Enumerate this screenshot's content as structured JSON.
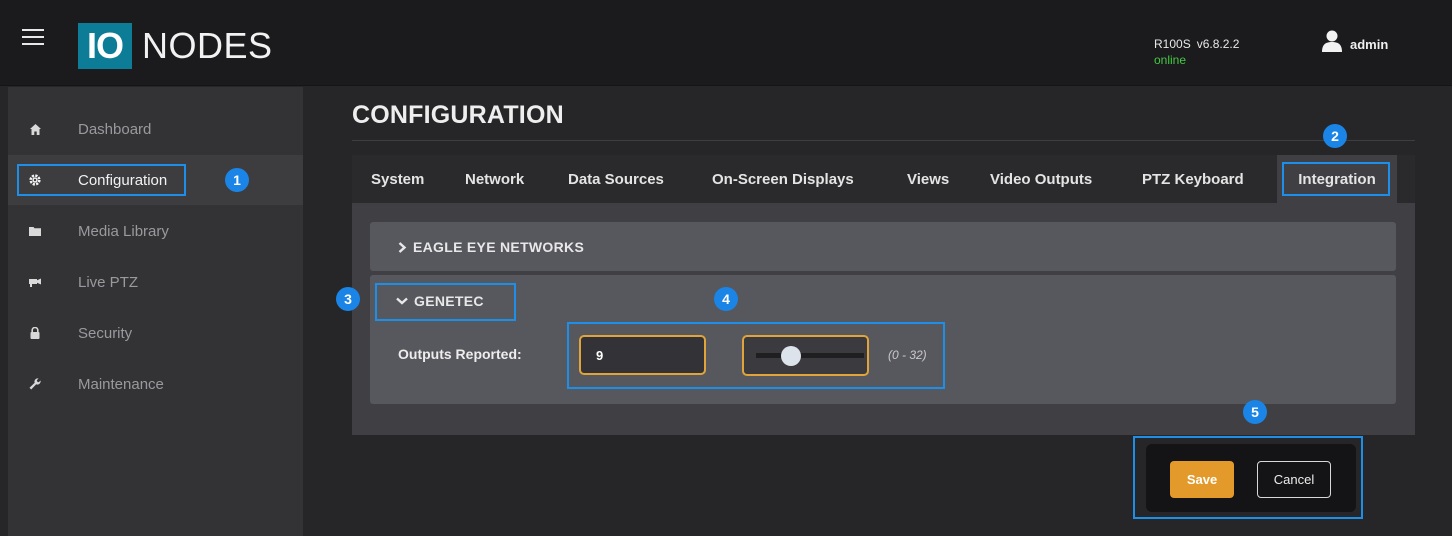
{
  "header": {
    "logo_mark": "IO",
    "logo_text": "NODES",
    "device_model": "R100S",
    "device_version": "v6.8.2.2",
    "device_status": "online",
    "username": "admin"
  },
  "sidebar": {
    "items": [
      {
        "label": "Dashboard",
        "icon": "home-icon",
        "active": false
      },
      {
        "label": "Configuration",
        "icon": "gear-icon",
        "active": true
      },
      {
        "label": "Media Library",
        "icon": "folder-icon",
        "active": false
      },
      {
        "label": "Live PTZ",
        "icon": "camera-icon",
        "active": false
      },
      {
        "label": "Security",
        "icon": "lock-icon",
        "active": false
      },
      {
        "label": "Maintenance",
        "icon": "wrench-icon",
        "active": false
      }
    ]
  },
  "main": {
    "title": "CONFIGURATION",
    "tabs": [
      "System",
      "Network",
      "Data Sources",
      "On-Screen Displays",
      "Views",
      "Video Outputs",
      "PTZ Keyboard",
      "Integration"
    ],
    "active_tab": "Integration",
    "sections": [
      {
        "label": "EAGLE EYE NETWORKS",
        "expanded": false
      },
      {
        "label": "GENETEC",
        "expanded": true
      }
    ],
    "outputs_reported": {
      "label": "Outputs Reported:",
      "value": "9",
      "range": "(0 - 32)",
      "slider_fraction": 0.28125
    }
  },
  "actions": {
    "save": "Save",
    "cancel": "Cancel"
  },
  "callouts": [
    "1",
    "2",
    "3",
    "4",
    "5"
  ],
  "colors": {
    "accent_blue": "#1e8fe8",
    "logo_teal": "#0d7d97",
    "save_orange": "#e39a2b",
    "input_border": "#e0a43a",
    "status_green": "#45c845"
  }
}
